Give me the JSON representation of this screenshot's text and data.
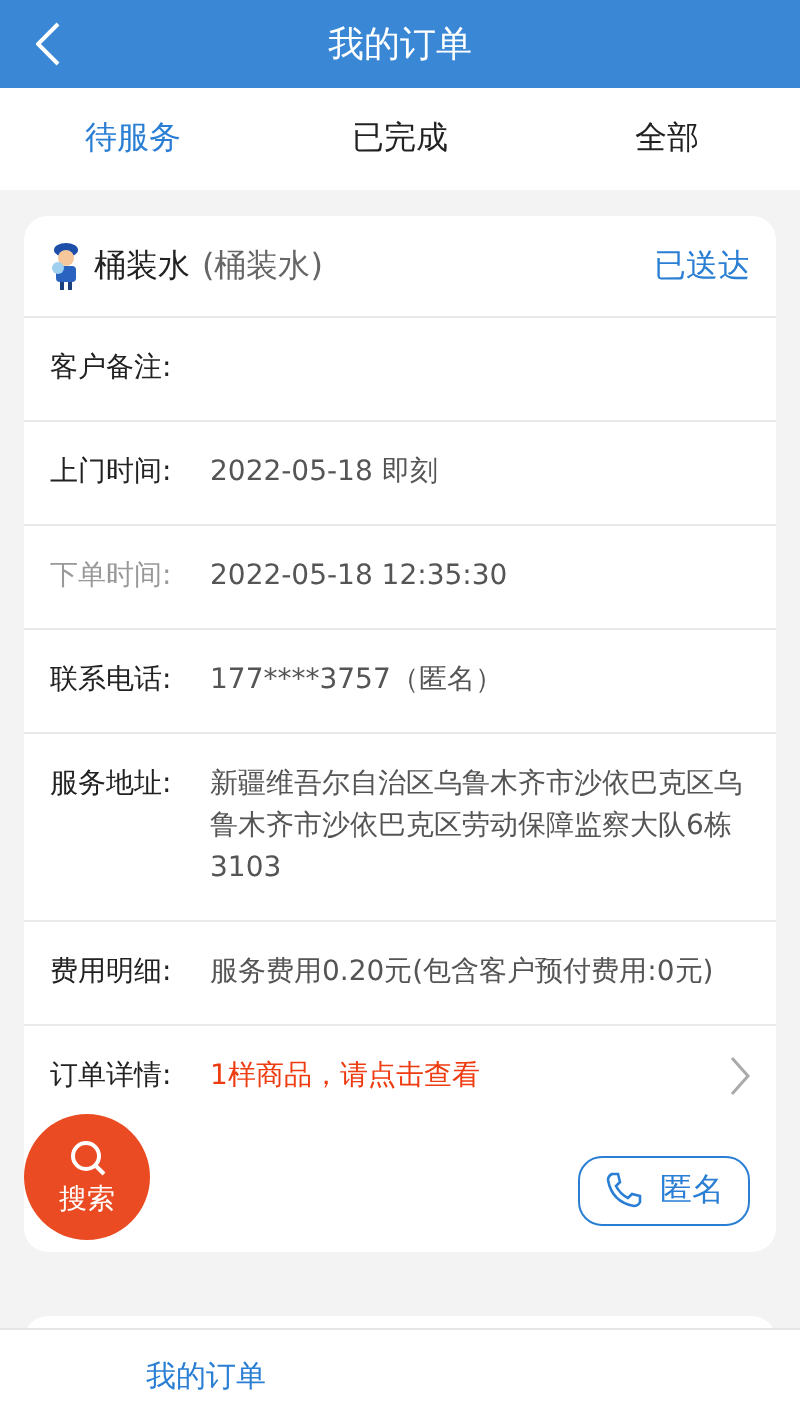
{
  "header": {
    "title": "我的订单"
  },
  "tabs": [
    {
      "label": "待服务",
      "selected": true
    },
    {
      "label": "已完成",
      "selected": false
    },
    {
      "label": "全部",
      "selected": false
    }
  ],
  "order": {
    "product": "桶装水",
    "product_note": "(桶装水)",
    "status": "已送达",
    "fields": [
      {
        "kind": "text",
        "label": "客户备注:",
        "dim": false
      },
      {
        "kind": "text",
        "label": "上门时间:",
        "value": "2022-05-18 即刻",
        "dim": false
      },
      {
        "kind": "text",
        "label": "下单时间:",
        "value": "2022-05-18 12:35:30",
        "dim": true
      },
      {
        "kind": "text",
        "label": "联系电话:",
        "value": "177****3757（匿名）",
        "dim": false
      },
      {
        "kind": "text",
        "label": "服务地址:",
        "value": "新疆维吾尔自治区乌鲁木齐市沙依巴克区乌鲁木齐市沙依巴克区劳动保障监察大队6栋3103",
        "dim": false
      },
      {
        "kind": "text",
        "label": "费用明细:",
        "value": "服务费用0.20元(包含客户预付费用:0元)",
        "dim": false
      },
      {
        "kind": "link",
        "label": "订单详情:",
        "value": "1样商品，请点击查看",
        "dim": false
      }
    ],
    "call_button": "匿名"
  },
  "search_button": "搜索",
  "bottom_nav": [
    {
      "label": "我的订单",
      "selected": true
    }
  ]
}
